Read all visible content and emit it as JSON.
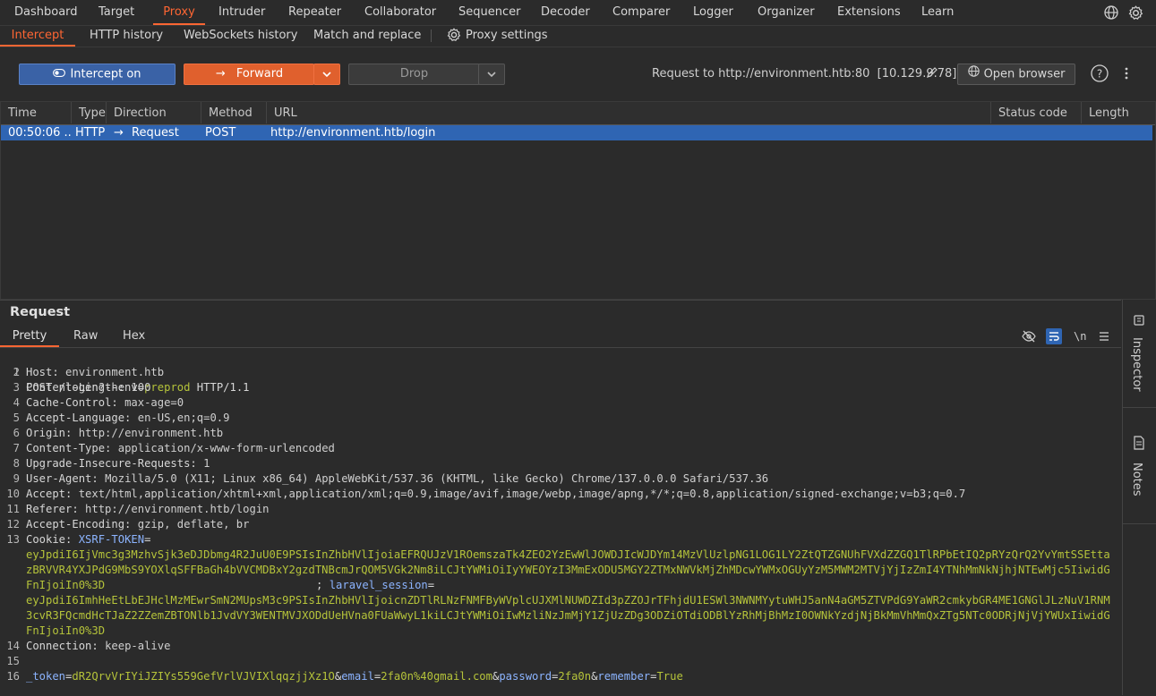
{
  "top_tabs": [
    "Dashboard",
    "Target",
    "Proxy",
    "Intruder",
    "Repeater",
    "Collaborator",
    "Sequencer",
    "Decoder",
    "Comparer",
    "Logger",
    "Organizer",
    "Extensions",
    "Learn"
  ],
  "sub_tabs": [
    "Intercept",
    "HTTP history",
    "WebSockets history",
    "Match and replace",
    "Proxy settings"
  ],
  "toolbar": {
    "intercept_label": "Intercept on",
    "forward_label": "Forward",
    "drop_label": "Drop",
    "request_to": "Request to http://environment.htb:80  [10.129.9.78]",
    "open_browser_label": "Open browser"
  },
  "table": {
    "columns": [
      "Time",
      "Type",
      "Direction",
      "Method",
      "URL",
      "Status code",
      "Length"
    ],
    "rows": [
      {
        "time": "00:50:06 ...",
        "type": "HTTP",
        "direction": "Request",
        "method": "POST",
        "url": "http://environment.htb/login",
        "status": "",
        "length": ""
      }
    ]
  },
  "request_panel": {
    "title": "Request",
    "tabs": [
      "Pretty",
      "Raw",
      "Hex"
    ],
    "newline_toggle": "\\n",
    "line_numbers": [
      "1",
      "2",
      "3",
      "4",
      "5",
      "6",
      "7",
      "8",
      "9",
      "10",
      "11",
      "12",
      "13",
      "14",
      "15",
      "16"
    ],
    "lines": {
      "l1_method": "POST ",
      "l1_path": "/login?--env",
      "l1_eq": "=",
      "l1_val": "preprod",
      "l1_proto": " HTTP/1.1",
      "l2k": "Host: ",
      "l2v": "environment.htb",
      "l3k": "Content-Length: ",
      "l3v": "100",
      "l4k": "Cache-Control: ",
      "l4v": "max-age=0",
      "l5k": "Accept-Language: ",
      "l5v": "en-US,en;q=0.9",
      "l6k": "Origin: ",
      "l6v": "http://environment.htb",
      "l7k": "Content-Type: ",
      "l7v": "application/x-www-form-urlencoded",
      "l8k": "Upgrade-Insecure-Requests: ",
      "l8v": "1",
      "l9k": "User-Agent: ",
      "l9v": "Mozilla/5.0 (X11; Linux x86_64) AppleWebKit/537.36 (KHTML, like Gecko) Chrome/137.0.0.0 Safari/537.36",
      "l10k": "Accept: ",
      "l10v": "text/html,application/xhtml+xml,application/xml;q=0.9,image/avif,image/webp,image/apng,*/*;q=0.8,application/signed-exchange;v=b3;q=0.7",
      "l11k": "Referer: ",
      "l11v": "http://environment.htb/login",
      "l12k": "Accept-Encoding: ",
      "l12v": "gzip, deflate, br",
      "l13k": "Cookie: ",
      "l13name1": "XSRF-TOKEN",
      "l13eq": "=",
      "xsrf_value": "eyJpdiI6IjVmc3g3MzhvSjk3eDJDbmg4R2JuU0E9PSIsInZhbHVlIjoiaEFRQUJzV1ROemszaTk4ZEO2YzEwWlJOWDJIcWJDYm14MzVlUzlpNG1LOG1LY2ZtQTZGNUhFVXdZZGQ1TlRPbEtIQ2pRYzQrQ2YvYmtSSEttazBRVVR4YXJPdG9MbS9YOXlqSFFBaGh4bVVCMDBxY2gzdTNBcmJrQOM5VGk2Nm8iLCJtYWMiOiIyYWEOYzI3MmExODU5MGY2ZTMxNWVkMjZhMDcwYWMxOGUyYzM5MWM2MTVjYjIzZmI4YTNhMmNkNjhjNTEwMjc5IiwidGFnIjoiIn0%3D",
      "l13sep": "; ",
      "l13name2": "laravel_session",
      "laravel_value": "eyJpdiI6ImhHeEtLbEJHclMzMEwrSmN2MUpsM3c9PSIsInZhbHVlIjoicnZDTlRLNzFNMFByWVplcUJXMlNUWDZId3pZZOJrTFhjdU1ESWl3NWNMYytuWHJ5anN4aGM5ZTVPdG9YaWR2cmkybGR4ME1GNGlJLzNuV1RNM3cvR3FQcmdHcTJaZ2ZZemZBTONlb1JvdVY3WENTMVJXODdUeHVna0FUaWwyL1kiLCJtYWMiOiIwMzliNzJmMjY1ZjUzZDg3ODZiOTdiODBlYzRhMjBhMzI0OWNkYzdjNjBkMmVhMmQxZTg5NTc0ODRjNjVjYWUxIiwidGFnIjoiIn0%3D",
      "l14k": "Connection: ",
      "l14v": "keep-alive",
      "body_k1": "_token",
      "body_v1": "dR2QrvVrIYiJZIYs559GefVrlVJVIXlqqzjjXz1O",
      "body_k2": "email",
      "body_v2": "2fa0n%40gmail.com",
      "body_k3": "password",
      "body_v3": "2fa0n",
      "body_k4": "remember",
      "body_v4": "True"
    }
  },
  "right_rail": {
    "inspector_label": "Inspector",
    "notes_label": "Notes"
  },
  "colors": {
    "accent": "#ff6633",
    "selection": "#2f65b3",
    "intercept": "#3a62a6",
    "forward": "#e0602d",
    "param_value": "#b5c33a",
    "param_key": "#8cb4ff"
  }
}
